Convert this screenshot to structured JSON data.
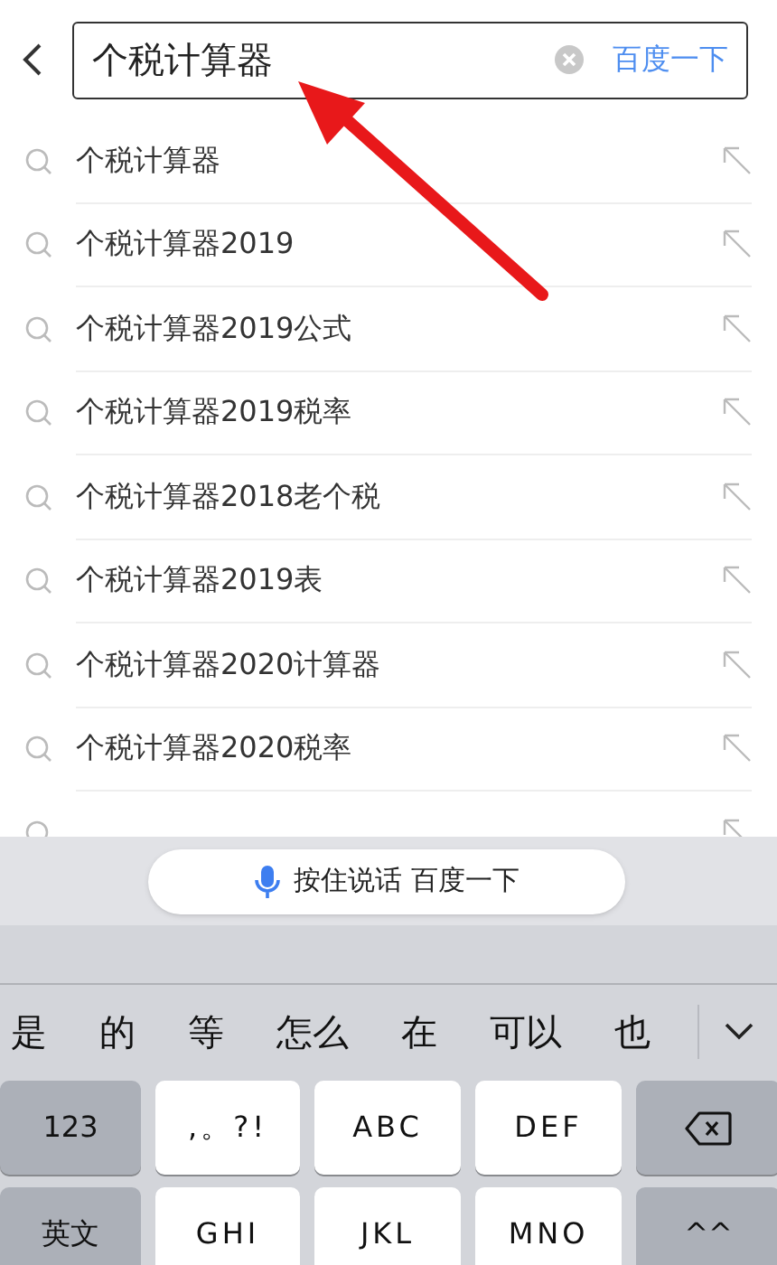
{
  "search": {
    "value": "个税计算器",
    "button": "百度一下"
  },
  "suggestions": [
    {
      "text": "个税计算器"
    },
    {
      "text": "个税计算器2019"
    },
    {
      "text": "个税计算器2019公式"
    },
    {
      "text": "个税计算器2019税率"
    },
    {
      "text": "个税计算器2018老个税"
    },
    {
      "text": "个税计算器2019表"
    },
    {
      "text": "个税计算器2020计算器"
    },
    {
      "text": "个税计算器2020税率"
    }
  ],
  "voice_button": "按住说话 百度一下",
  "candidates": [
    "是",
    "的",
    "等",
    "怎么",
    "在",
    "可以",
    "也"
  ],
  "keys": [
    {
      "label": "123",
      "kind": "function"
    },
    {
      "label": ",。?!",
      "kind": "letter"
    },
    {
      "label": "ABC",
      "kind": "letter"
    },
    {
      "label": "DEF",
      "kind": "letter"
    },
    {
      "kind": "backspace"
    },
    {
      "label": "英文",
      "kind": "function"
    },
    {
      "label": "GHI",
      "kind": "letter"
    },
    {
      "label": "JKL",
      "kind": "letter"
    },
    {
      "label": "MNO",
      "kind": "letter"
    },
    {
      "label": "^^",
      "kind": "function"
    }
  ]
}
